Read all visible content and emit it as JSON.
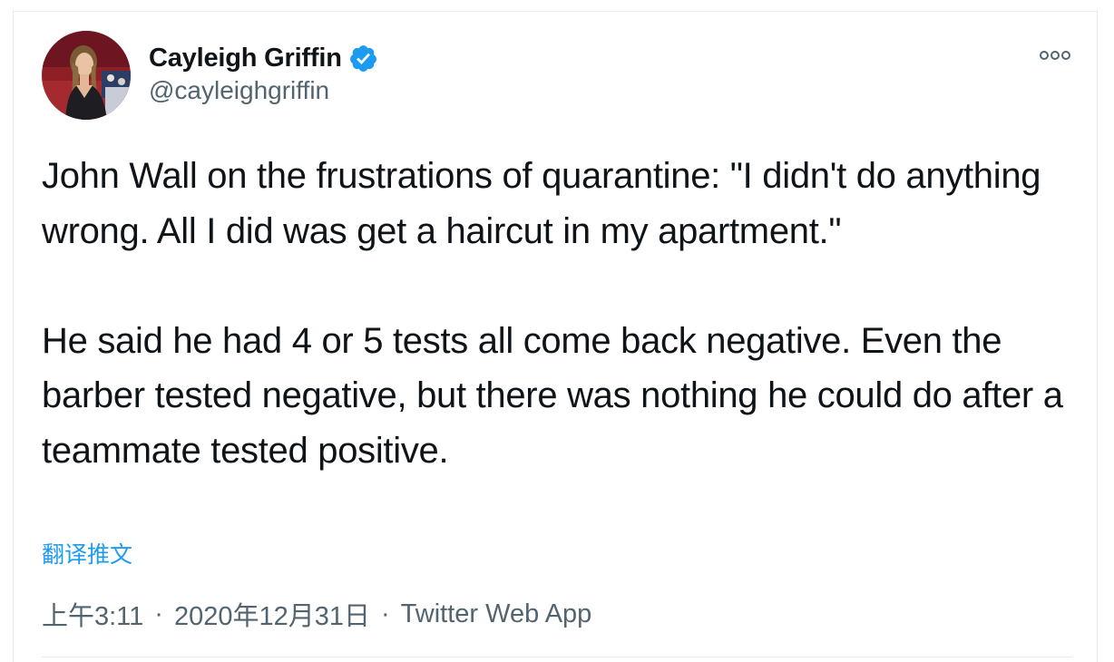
{
  "tweet": {
    "author": {
      "display_name": "Cayleigh Griffin",
      "handle": "@cayleighgriffin",
      "verified": true,
      "avatar_icon": "profile-photo"
    },
    "more_icon": "ellipsis-icon",
    "paragraphs": [
      "John Wall on the frustrations of quarantine: \"I didn't do anything wrong. All I did was get a haircut in my apartment.\"",
      "He said he had 4 or 5 tests all come back negative. Even the barber tested negative, but there was nothing he could do after a teammate tested positive."
    ],
    "translate_label": "翻译推文",
    "time": "上午3:11",
    "separator": "·",
    "date": "2020年12月31日",
    "source": "Twitter Web App"
  },
  "colors": {
    "text_primary": "#0f1419",
    "text_secondary": "#536471",
    "accent": "#1d9bf0",
    "border": "#e6ecf0"
  }
}
